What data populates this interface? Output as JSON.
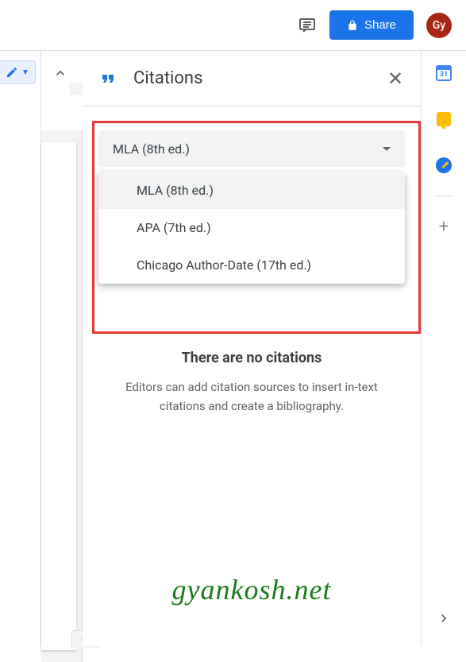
{
  "topbar": {
    "share_label": "Share",
    "avatar_initials": "Gy"
  },
  "panel": {
    "title": "Citations"
  },
  "format_select": {
    "selected": "MLA (8th ed.)",
    "options": [
      "MLA (8th ed.)",
      "APA (7th ed.)",
      "Chicago Author-Date (17th ed.)"
    ]
  },
  "empty_state": {
    "title": "There are no citations",
    "description": "Editors can add citation sources to insert in-text citations and create a bibliography."
  },
  "watermark": "gyankosh.net",
  "calendar_day": "31"
}
